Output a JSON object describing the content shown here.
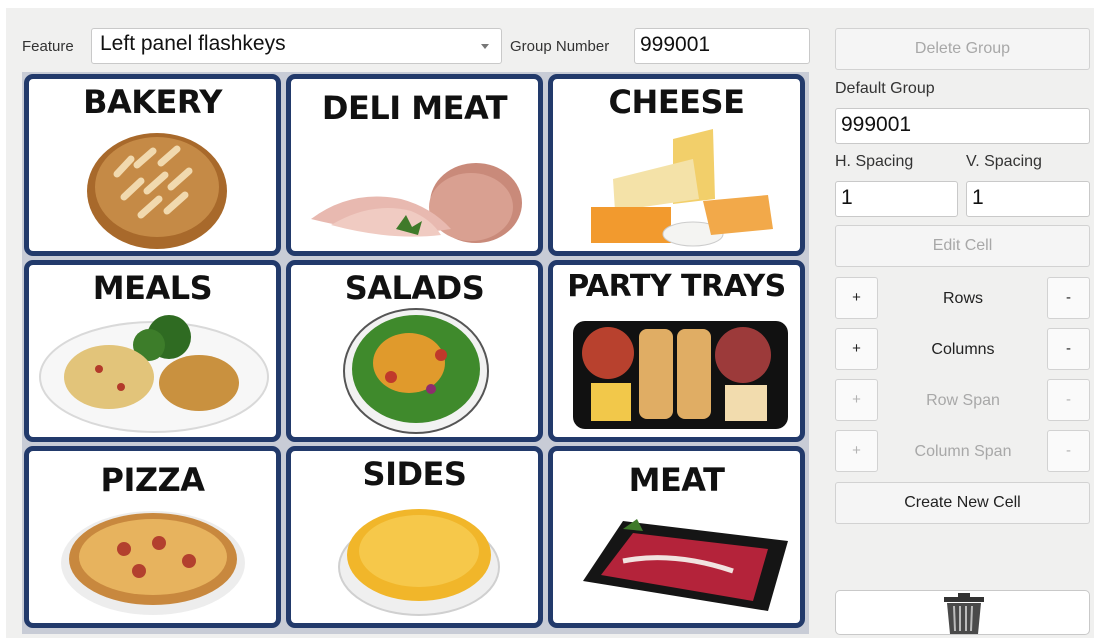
{
  "toolbar": {
    "feature_label": "Feature",
    "feature_value": "Left panel flashkeys",
    "group_number_label": "Group Number",
    "group_number_value": "999001"
  },
  "grid": {
    "cells": [
      {
        "title": "BAKERY",
        "image": "bread-loaf"
      },
      {
        "title": "DELI MEAT",
        "image": "sliced-ham"
      },
      {
        "title": "CHEESE",
        "image": "cheese-assortment"
      },
      {
        "title": "MEALS",
        "image": "pasta-chicken-plate"
      },
      {
        "title": "SALADS",
        "image": "salad-bowl"
      },
      {
        "title": "PARTY TRAYS",
        "image": "party-tray"
      },
      {
        "title": "PIZZA",
        "image": "pizza"
      },
      {
        "title": "SIDES",
        "image": "macaroni-bowl"
      },
      {
        "title": "MEAT",
        "image": "raw-steak"
      }
    ]
  },
  "panel": {
    "delete_group": "Delete Group",
    "default_group_label": "Default Group",
    "default_group_value": "999001",
    "h_spacing_label": "H. Spacing",
    "h_spacing_value": "1",
    "v_spacing_label": "V. Spacing",
    "v_spacing_value": "1",
    "edit_cell": "Edit Cell",
    "rows_label": "Rows",
    "columns_label": "Columns",
    "row_span_label": "Row Span",
    "column_span_label": "Column Span",
    "plus": "+",
    "minus": "-",
    "create_new_cell": "Create New Cell"
  },
  "icons": {
    "dropdown": "chevron-down-icon",
    "trash": "trash-icon"
  },
  "colors": {
    "cell_border": "#223a6b",
    "background": "#f0f0ef"
  }
}
